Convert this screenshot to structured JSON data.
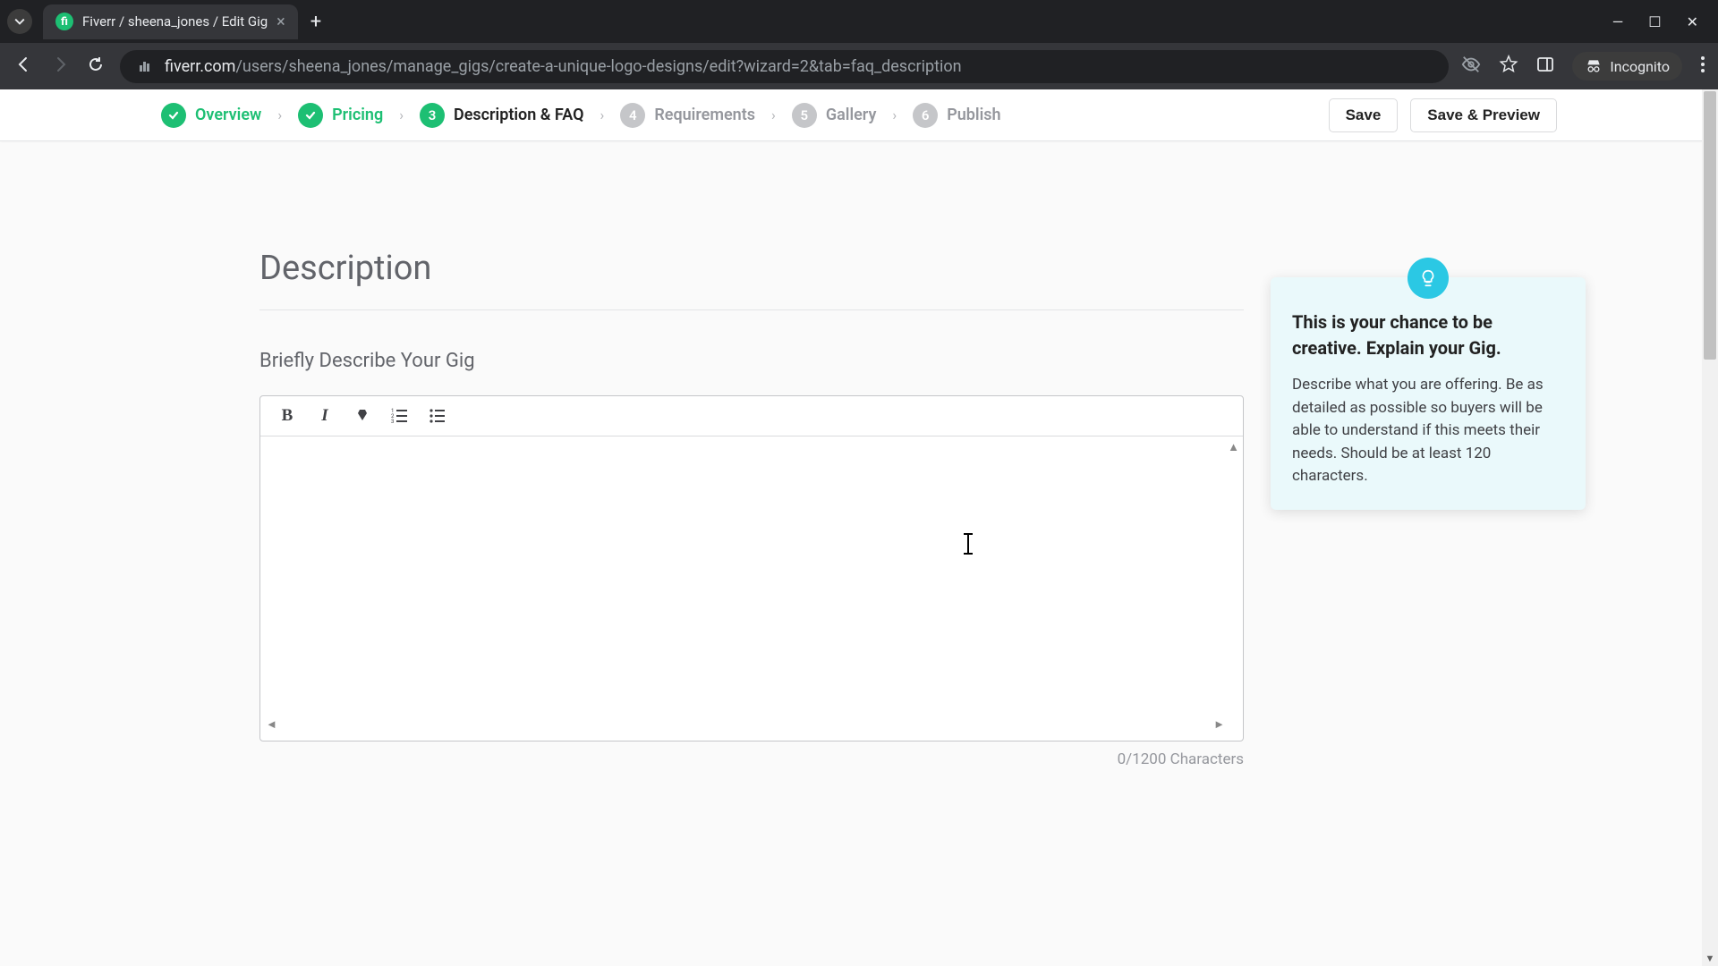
{
  "browser": {
    "tab_title": "Fiverr / sheena_jones / Edit Gig",
    "url_host": "fiverr.com",
    "url_path": "/users/sheena_jones/manage_gigs/create-a-unique-logo-designs/edit?wizard=2&tab=faq_description",
    "incognito_label": "Incognito"
  },
  "wizard": {
    "steps": [
      {
        "num": "✓",
        "label": "Overview",
        "state": "done"
      },
      {
        "num": "✓",
        "label": "Pricing",
        "state": "done"
      },
      {
        "num": "3",
        "label": "Description & FAQ",
        "state": "active"
      },
      {
        "num": "4",
        "label": "Requirements",
        "state": "pending"
      },
      {
        "num": "5",
        "label": "Gallery",
        "state": "pending"
      },
      {
        "num": "6",
        "label": "Publish",
        "state": "pending"
      }
    ],
    "save_label": "Save",
    "save_preview_label": "Save & Preview"
  },
  "section": {
    "title": "Description",
    "field_label": "Briefly Describe Your Gig"
  },
  "editor": {
    "char_counter": "0/1200 Characters"
  },
  "tip": {
    "title": "This is your chance to be creative. Explain your Gig.",
    "body": "Describe what you are offering. Be as detailed as possible so buyers will be able to understand if this meets their needs. Should be at least 120 characters."
  }
}
